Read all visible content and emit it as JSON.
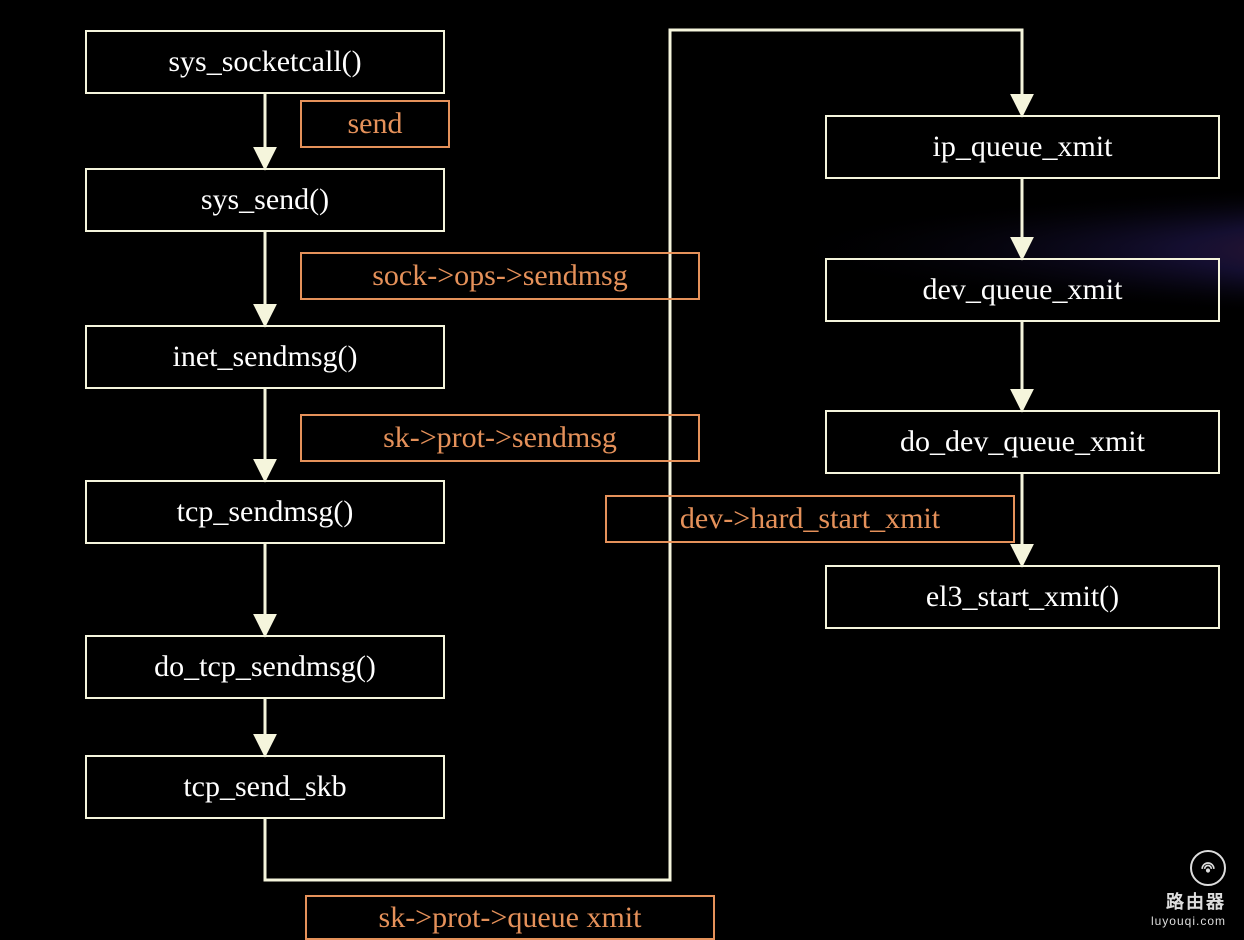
{
  "nodes": {
    "sys_socketcall": "sys_socketcall()",
    "sys_send": "sys_send()",
    "inet_sendmsg": "inet_sendmsg()",
    "tcp_sendmsg": "tcp_sendmsg()",
    "do_tcp_sendmsg": "do_tcp_sendmsg()",
    "tcp_send_skb": "tcp_send_skb",
    "ip_queue_xmit": "ip_queue_xmit",
    "dev_queue_xmit": "dev_queue_xmit",
    "do_dev_queue_xmit": "do_dev_queue_xmit",
    "el3_start_xmit": "el3_start_xmit()"
  },
  "labels": {
    "send": "send",
    "sock_ops_sendmsg": "sock->ops->sendmsg",
    "sk_prot_sendmsg": "sk->prot->sendmsg",
    "dev_hard_start_xmit": "dev->hard_start_xmit",
    "sk_prot_queue_xmit": "sk->prot->queue xmit"
  },
  "colors": {
    "box_border": "#f5f5dc",
    "label_border": "#e5915a",
    "label_text": "#e5915a",
    "text": "#ffffff",
    "bg": "#000000"
  },
  "watermark": {
    "title": "路由器",
    "url": "luyouqi.com"
  }
}
